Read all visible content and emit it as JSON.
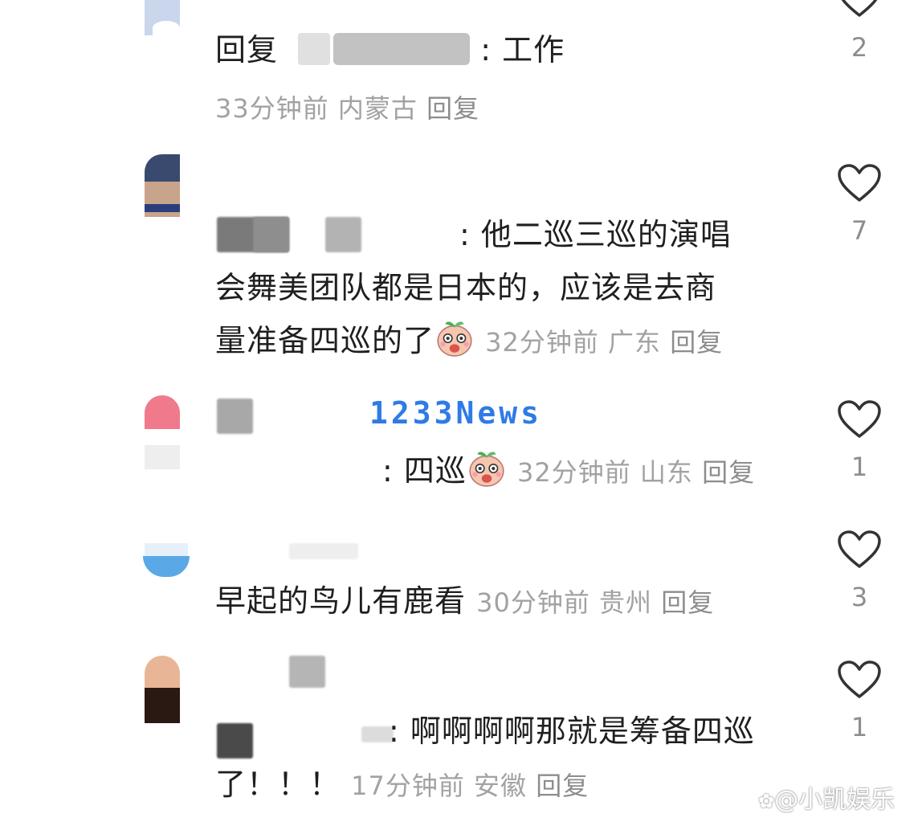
{
  "comments": [
    {
      "reply_prefix": "回复",
      "text": ": 工作",
      "time": "33分钟前",
      "region": "内蒙古",
      "reply": "回复",
      "likes": "2"
    },
    {
      "text_line1": ": 他二巡三巡的演唱",
      "text_line2": "会舞美团队都是日本的，应该是去商",
      "text_line3": "量准备四巡的了",
      "time": "32分钟前",
      "region": "广东",
      "reply": "回复",
      "likes": "7"
    },
    {
      "text": ": 四巡",
      "time": "32分钟前",
      "region": "山东",
      "reply": "回复",
      "likes": "1"
    },
    {
      "text": "早起的鸟儿有鹿看",
      "time": "30分钟前",
      "region": "贵州",
      "reply": "回复",
      "likes": "3"
    },
    {
      "text_line1": ": 啊啊啊啊那就是筹备四巡",
      "text_line2": "了！！！",
      "time": "17分钟前",
      "region": "安徽",
      "reply": "回复",
      "likes": "1"
    }
  ],
  "overlay_watermark": "1233News",
  "corner_watermark": "@小凯娱乐",
  "colors": {
    "text": "#1f1f1f",
    "meta": "#a2a2a2",
    "heart_stroke": "#333333",
    "watermark_blue": "#2f7be6"
  },
  "icons": {
    "like": "heart-outline-icon",
    "emoji": "peach-emoji-icon",
    "corner_logo": "paw-icon"
  }
}
